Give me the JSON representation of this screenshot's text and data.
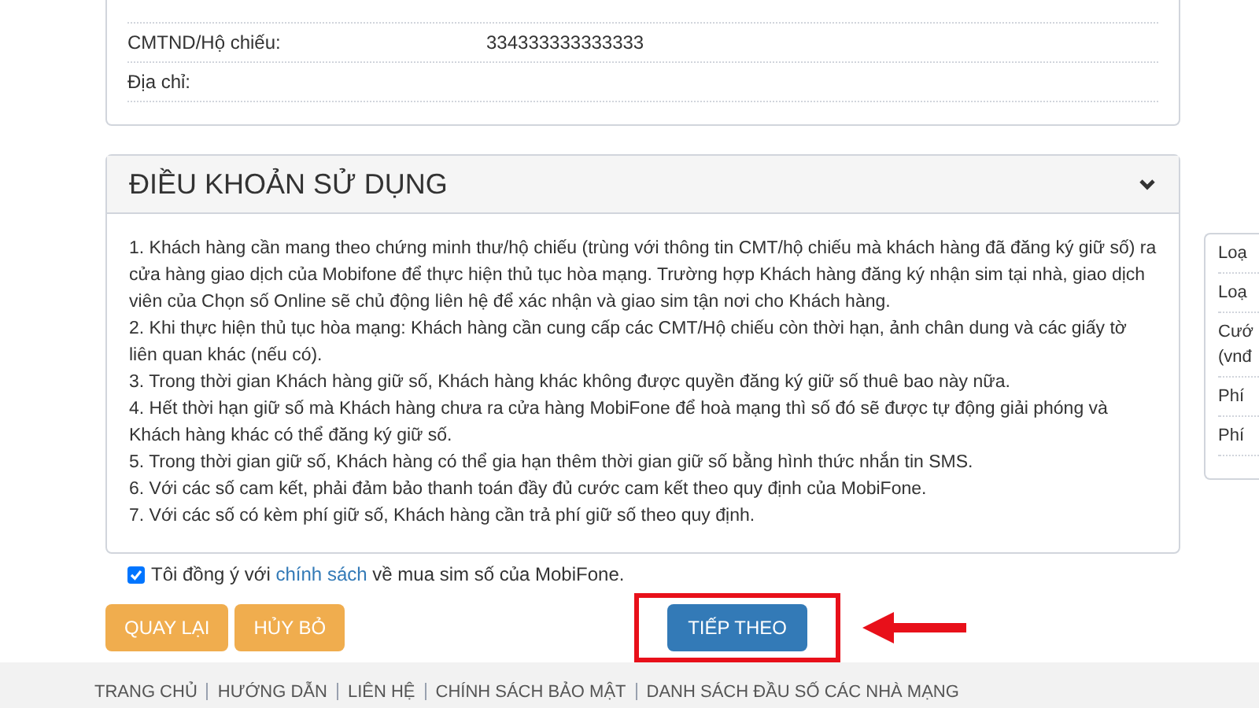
{
  "info_rows": [
    {
      "label": "CMTND/Hộ chiếu:",
      "value": "334333333333333"
    },
    {
      "label": "Địa chỉ:",
      "value": ""
    }
  ],
  "terms": {
    "title": "ĐIỀU KHOẢN SỬ DỤNG",
    "expanded": true,
    "lines": [
      "1. Khách hàng cần mang theo chứng minh thư/hộ chiếu (trùng với thông tin CMT/hộ chiếu mà khách hàng đã đăng ký giữ số) ra cửa hàng giao dịch của Mobifone để thực hiện thủ tục hòa mạng. Trường hợp Khách hàng đăng ký nhận sim tại nhà, giao dịch viên của Chọn số Online sẽ chủ động liên hệ để xác nhận và giao sim tận nơi cho Khách hàng.",
      "2. Khi thực hiện thủ tục hòa mạng: Khách hàng cần cung cấp các CMT/Hộ chiếu còn thời hạn, ảnh chân dung và các giấy tờ liên quan khác (nếu có).",
      "3. Trong thời gian Khách hàng giữ số, Khách hàng khác không được quyền đăng ký giữ số thuê bao này nữa.",
      "4. Hết thời hạn giữ số mà Khách hàng chưa ra cửa hàng MobiFone để hoà mạng thì số đó sẽ được tự động giải phóng và Khách hàng khác có thể đăng ký giữ số.",
      "5. Trong thời gian giữ số, Khách hàng có thể gia hạn thêm thời gian giữ số bằng hình thức nhắn tin SMS.",
      "6. Với các số cam kết, phải đảm bảo thanh toán đầy đủ cước cam kết theo quy định của MobiFone.",
      "7. Với các số có kèm phí giữ số, Khách hàng cần trả phí giữ số theo quy định."
    ]
  },
  "agree": {
    "checked": true,
    "before": "Tôi đồng ý với",
    "link": "chính sách",
    "after": "về mua sim số của MobiFone."
  },
  "buttons": [
    {
      "label": "QUAY LẠI",
      "kind": "secondary"
    },
    {
      "label": "HỦY BỎ",
      "kind": "secondary"
    },
    {
      "label": "TIẾP THEO",
      "kind": "primary"
    }
  ],
  "sidebar_rows": [
    [
      "Loạ"
    ],
    [
      "Loạ"
    ],
    [
      "Cướ",
      "(vnđ"
    ],
    [
      "Phí"
    ],
    [
      "Phí"
    ]
  ],
  "footer_links": [
    "TRANG CHỦ",
    "HƯỚNG DẪN",
    "LIÊN HỆ",
    "CHÍNH SÁCH BẢO MẬT",
    "DANH SÁCH ĐẦU SỐ CÁC NHÀ MẠNG"
  ]
}
